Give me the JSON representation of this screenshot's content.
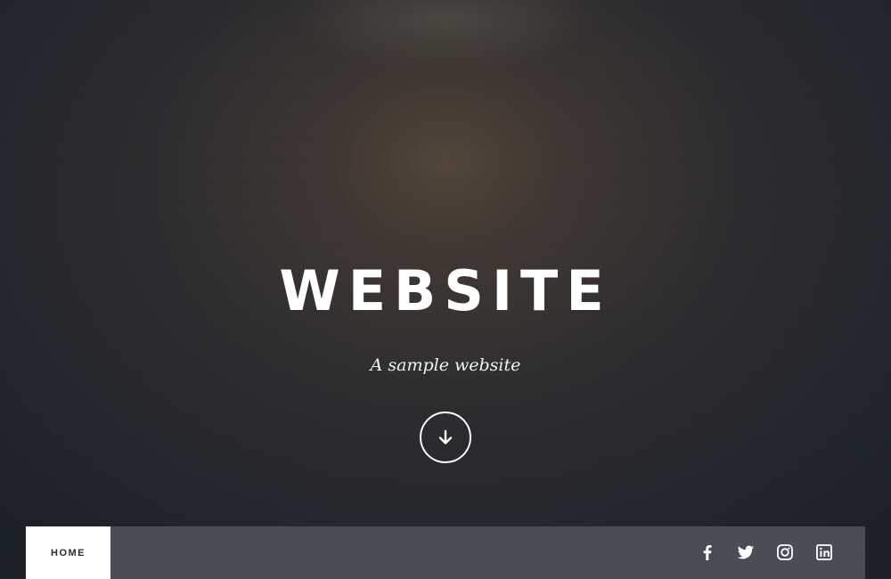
{
  "hero": {
    "title": "WEBSITE",
    "tagline": "A sample website",
    "scroll_icon": "arrow-down-icon"
  },
  "nav": {
    "home_label": "HOME",
    "social": [
      {
        "name": "facebook-icon"
      },
      {
        "name": "twitter-icon"
      },
      {
        "name": "instagram-icon"
      },
      {
        "name": "linkedin-icon"
      }
    ]
  },
  "colors": {
    "background": "#1e2229",
    "nav_bar": "#4a4d56",
    "nav_active": "#ffffff",
    "text": "#ffffff"
  }
}
